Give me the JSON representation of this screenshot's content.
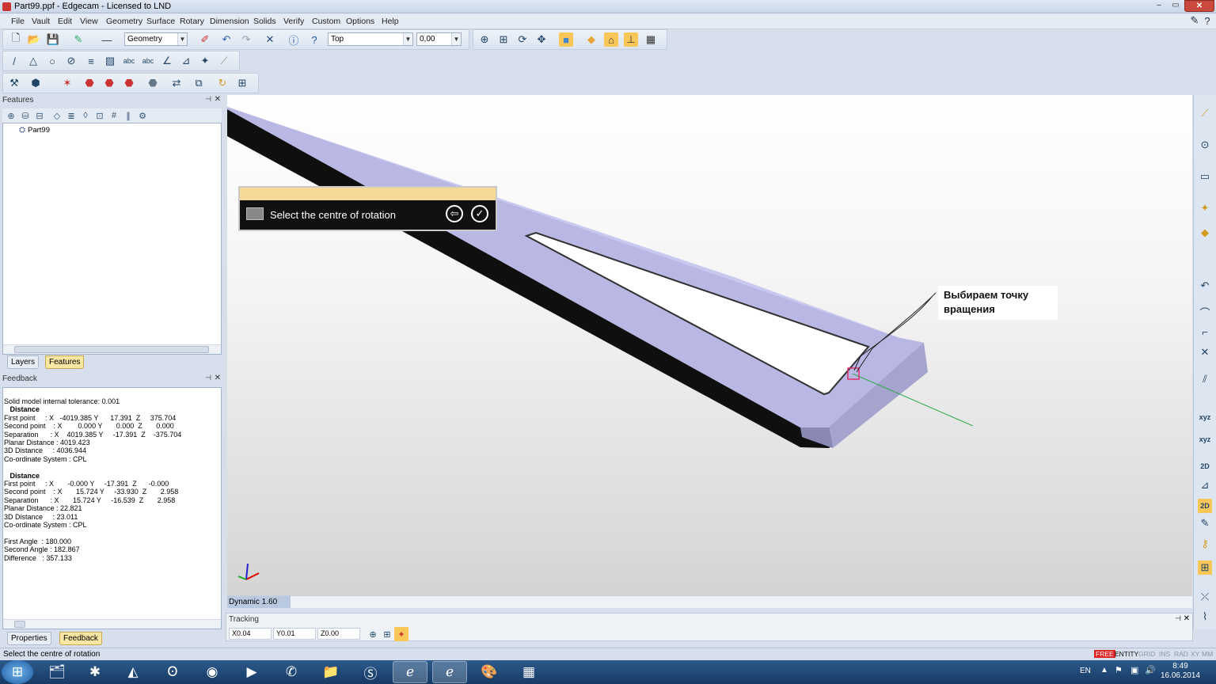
{
  "window": {
    "title": "Part99.ppf - Edgecam - Licensed to LND",
    "min": "‒",
    "max": "▭",
    "close": "✕"
  },
  "menu": [
    "File",
    "Vault",
    "Edit",
    "View",
    "Geometry",
    "Surface",
    "Rotary",
    "Dimension",
    "Solids",
    "Verify",
    "Custom",
    "Options",
    "Help"
  ],
  "toolbar": {
    "geometry_combo": "Geometry",
    "view_combo": "Top",
    "depth_combo": "0,00"
  },
  "features_panel": {
    "title": "Features",
    "tree_item": "Part99",
    "tabs": [
      "Layers",
      "Features"
    ]
  },
  "feedback_panel": {
    "title": "Feedback",
    "lines": [
      {
        "t": "Solid model internal tolerance: 0.001",
        "h": false
      },
      {
        "t": "   Distance",
        "h": true
      },
      {
        "t": "First point     : X   -4019.385 Y      17.391  Z     375.704",
        "h": false
      },
      {
        "t": "Second point    : X        0.000 Y       0.000  Z       0.000",
        "h": false
      },
      {
        "t": "Separation      : X    4019.385 Y     -17.391  Z    -375.704",
        "h": false
      },
      {
        "t": "Planar Distance : 4019.423",
        "h": false
      },
      {
        "t": "3D Distance     : 4036.944",
        "h": false
      },
      {
        "t": "Co-ordinate System : CPL",
        "h": false
      },
      {
        "t": " ",
        "h": false
      },
      {
        "t": "   Distance",
        "h": true
      },
      {
        "t": "First point     : X       -0.000 Y     -17.391  Z      -0.000",
        "h": false
      },
      {
        "t": "Second point    : X       15.724 Y     -33.930  Z       2.958",
        "h": false
      },
      {
        "t": "Separation      : X       15.724 Y     -16.539  Z       2.958",
        "h": false
      },
      {
        "t": "Planar Distance : 22.821",
        "h": false
      },
      {
        "t": "3D Distance     : 23.011",
        "h": false
      },
      {
        "t": "Co-ordinate System : CPL",
        "h": false
      },
      {
        "t": " ",
        "h": false
      },
      {
        "t": "First Angle  : 180.000",
        "h": false
      },
      {
        "t": "Second Angle : 182.867",
        "h": false
      },
      {
        "t": "Difference   : 357.133",
        "h": false
      }
    ],
    "tabs": [
      "Properties",
      "Feedback"
    ]
  },
  "prompt": {
    "message": "Select the centre of rotation",
    "back": "⇦",
    "ok": "✓"
  },
  "annotation": {
    "line1": "Выбираем точку",
    "line2": "вращения"
  },
  "dynamic": {
    "label": "Dynamic 1.60"
  },
  "tracking": {
    "title": "Tracking",
    "x": "X0.04",
    "y": "Y0.01",
    "z": "Z0.00"
  },
  "status": {
    "text": "Select the centre of rotation",
    "flags": [
      "FREE",
      "ENTITY",
      "GRID",
      "INS",
      "RAD",
      "XY",
      "MM"
    ]
  },
  "taskbar": {
    "lang": "EN",
    "time": "8:49",
    "date": "16.06.2014"
  },
  "colors": {
    "part_top": "#b9b8e4",
    "part_side": "#111111",
    "prompt_header": "#f5d995",
    "axis_green": "#2ea84a"
  }
}
